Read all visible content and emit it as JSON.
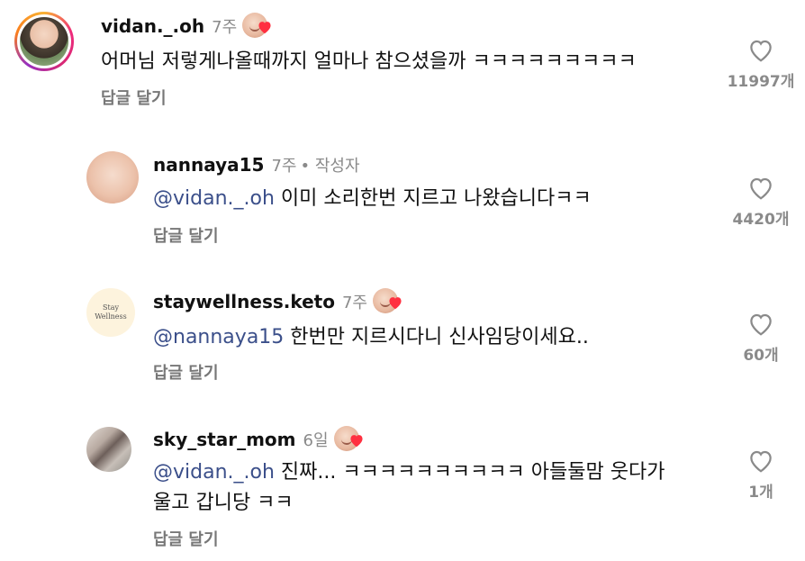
{
  "comments": [
    {
      "username": "vidan._.oh",
      "time": "7주",
      "text": "어머님 저렇게나올때까지 얼마나 참으셨을까 ㅋㅋㅋㅋㅋㅋㅋㅋㅋ",
      "reply_label": "답글 달기",
      "likes": "11997개",
      "liked_by_author": true
    },
    {
      "username": "nannaya15",
      "time": "7주",
      "author_badge": "• 작성자",
      "mention": "@vidan._.oh",
      "text": " 이미 소리한번 지르고 나왔습니다ㅋㅋ",
      "reply_label": "답글 달기",
      "likes": "4420개"
    },
    {
      "username": "staywellness.keto",
      "time": "7주",
      "avatar_text_1": "Stay",
      "avatar_text_2": "Wellness",
      "mention": "@nannaya15",
      "text": " 한번만 지르시다니 신사임당이세요..",
      "reply_label": "답글 달기",
      "likes": "60개",
      "liked_by_author": true
    },
    {
      "username": "sky_star_mom",
      "time": "6일",
      "mention": "@vidan._.oh",
      "text_line1": " 진짜... ㅋㅋㅋㅋㅋㅋㅋㅋㅋㅋ 아들둘맘 웃다가",
      "text_line2": "울고 갑니당 ㅋㅋ",
      "reply_label": "답글 달기",
      "likes": "1개",
      "liked_by_author": true
    }
  ],
  "colors": {
    "mention": "#3b4f8a",
    "heart": "#ff3040",
    "muted": "#8a8a8a"
  },
  "icons": {
    "like": "heart-outline-icon",
    "author_like": "heart-filled-icon"
  }
}
